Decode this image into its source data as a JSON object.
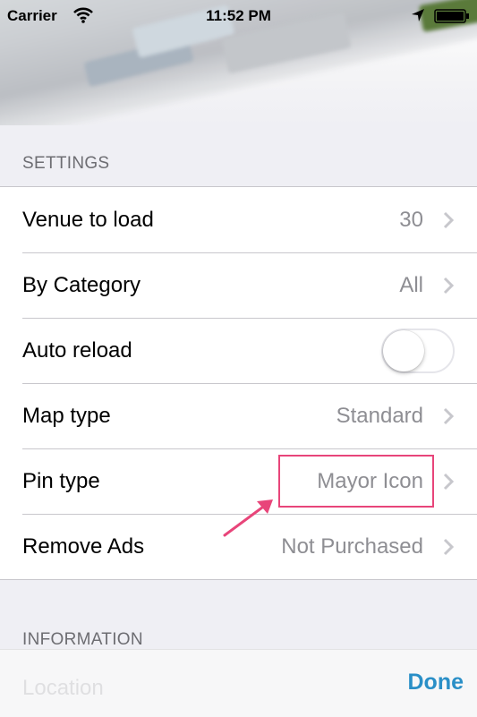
{
  "status_bar": {
    "carrier": "Carrier",
    "time": "11:52 PM"
  },
  "settings": {
    "header": "SETTINGS",
    "rows": [
      {
        "label": "Venue to load",
        "value": "30"
      },
      {
        "label": "By Category",
        "value": "All"
      },
      {
        "label": "Auto reload",
        "toggle_on": false
      },
      {
        "label": "Map type",
        "value": "Standard"
      },
      {
        "label": "Pin type",
        "value": "Mayor Icon"
      },
      {
        "label": "Remove Ads",
        "value": "Not Purchased"
      }
    ]
  },
  "information": {
    "header": "INFORMATION",
    "first_row_label": "Location"
  },
  "toolbar": {
    "done_label": "Done"
  },
  "colors": {
    "accent": "#2a8fc7",
    "annotation": "#e8457a",
    "secondary_text": "#8e8e93"
  },
  "icons": [
    "wifi-icon",
    "location-arrow-icon",
    "battery-icon",
    "chevron-right-icon"
  ]
}
